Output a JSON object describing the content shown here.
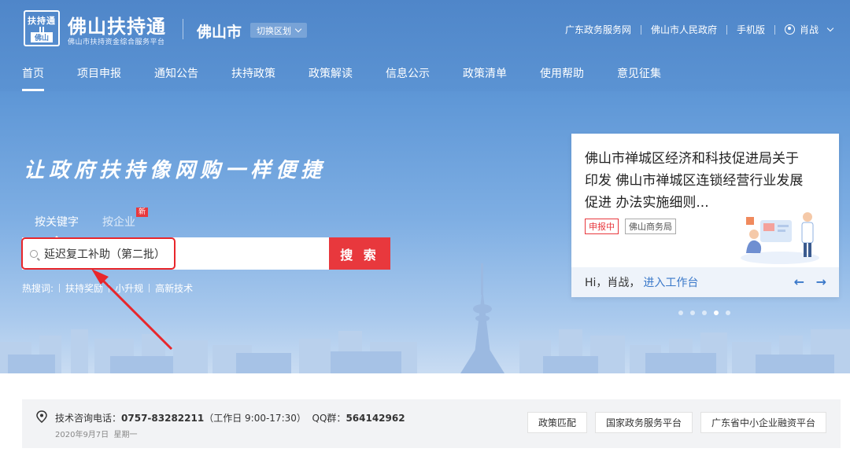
{
  "brand": {
    "logo_top": "扶持通",
    "logo_bottom": "佛山",
    "title": "佛山扶持通",
    "subtitle": "佛山市扶持资金综合服务平台"
  },
  "city": {
    "name": "佛山市",
    "switch_label": "切换区划"
  },
  "top_links": [
    "广东政务服务网",
    "佛山市人民政府",
    "手机版"
  ],
  "user": {
    "name": "肖战"
  },
  "nav": [
    {
      "label": "首页",
      "active": true
    },
    {
      "label": "项目申报"
    },
    {
      "label": "通知公告"
    },
    {
      "label": "扶持政策"
    },
    {
      "label": "政策解读"
    },
    {
      "label": "信息公示"
    },
    {
      "label": "政策清单"
    },
    {
      "label": "使用帮助"
    },
    {
      "label": "意见征集"
    }
  ],
  "hero": {
    "slogan": "让政府扶持像网购一样便捷",
    "tabs": [
      {
        "label": "按关键字",
        "active": true
      },
      {
        "label": "按企业",
        "badge": "新"
      }
    ],
    "search": {
      "value": "延迟复工补助（第二批）",
      "button_label": "搜 索"
    },
    "hot": {
      "label": "热搜词:",
      "items": [
        "扶持奖励",
        "小升规",
        "高新技术"
      ]
    }
  },
  "card": {
    "title": "佛山市禅城区经济和科技促进局关于印发 佛山市禅城区连锁经营行业发展促进 办法实施细则...",
    "tag_status": "申报中",
    "tag_org": "佛山商务局",
    "greeting": "Hi，肖战，",
    "workbench_link": "进入工作台",
    "prev_arrow": "←",
    "next_arrow": "→",
    "dots_total": 5,
    "active_dot": 4
  },
  "info": {
    "phone_label": "技术咨询电话：",
    "phone": "0757-83282211",
    "hours": "（工作日 9:00-17:30）",
    "qq_label": "QQ群：",
    "qq": "564142962",
    "date": "2020年9月7日",
    "weekday": "星期一",
    "buttons": [
      "政策匹配",
      "国家政务服务平台",
      "广东省中小企业融资平台"
    ]
  },
  "colors": {
    "header_blue": "#4f86c9",
    "accent_red": "#e8383d",
    "link_blue": "#3a78c9"
  }
}
